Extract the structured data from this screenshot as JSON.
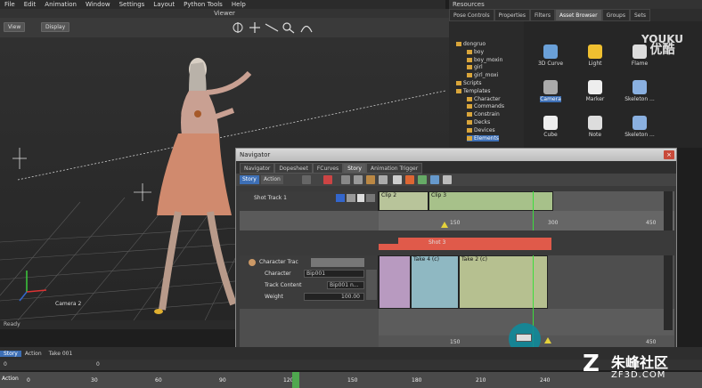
{
  "menu": [
    "File",
    "Edit",
    "Animation",
    "Window",
    "Settings",
    "Layout",
    "Python Tools",
    "Help"
  ],
  "viewer": {
    "title": "Viewer",
    "view_label": "View",
    "display_label": "Display",
    "camera_label": "Camera 2",
    "status": "Ready"
  },
  "resources": {
    "title": "Resources",
    "tabs": [
      "Pose Controls",
      "Properties",
      "Filters",
      "Asset Browser",
      "Groups",
      "Sets"
    ],
    "active_tab": 3,
    "tree": [
      "dongruo",
      "boy",
      "boy_moxin",
      "girl",
      "girl_moxi",
      "Scripts",
      "Templates",
      "Character",
      "Commands",
      "Constrain",
      "Decks",
      "Devices",
      "Elements"
    ],
    "assets": [
      {
        "name": "3D Curve",
        "icon": "curve-icon"
      },
      {
        "name": "Light",
        "icon": "light-icon"
      },
      {
        "name": "Flame",
        "icon": "flame-icon"
      },
      {
        "name": "Camera",
        "icon": "camera-icon"
      },
      {
        "name": "Marker",
        "icon": "marker-icon"
      },
      {
        "name": "Skeleton ...",
        "icon": "skeleton-icon"
      },
      {
        "name": "Cube",
        "icon": "cube-icon"
      },
      {
        "name": "Note",
        "icon": "note-icon"
      },
      {
        "name": "Skeleton ...",
        "icon": "skeleton-icon"
      }
    ],
    "selected_asset": 3
  },
  "navigator": {
    "title": "Navigator",
    "close": "×",
    "tabs": [
      "Navigator",
      "Dopesheet",
      "FCurves",
      "Story",
      "Animation Trigger"
    ],
    "active_tab": 3,
    "toolbar": {
      "story": "Story",
      "action": "Action"
    },
    "shot_track": "Shot Track 1",
    "clips": {
      "clip2": "Clip 2",
      "clip3": "Clip 3",
      "shot3": "Shot 3",
      "take4": "Take 4 (c)",
      "take2": "Take 2 (c)"
    },
    "ruler": {
      "a": "150",
      "b": "300",
      "c": "450"
    },
    "char_track": "Character Trac",
    "character_label": "Character",
    "character_value": "Bip001",
    "track_content_label": "Track Content",
    "track_content_value": "Bip001 n...",
    "weight_label": "Weight",
    "weight_value": "100.00"
  },
  "bottom": {
    "story": "Story",
    "action": "Action",
    "take": "Take 001",
    "frame_start": "0",
    "frame_cur": "0",
    "ticks": [
      "0",
      "30",
      "60",
      "90",
      "120",
      "150",
      "180",
      "210",
      "240"
    ],
    "action_label": "Action"
  },
  "watermarks": {
    "youku": "YOUKU",
    "youku_cn": "优酷",
    "zf": "朱峰社区",
    "zf_url": "ZF3D.COM"
  },
  "colors": {
    "accent": "#3d6fb5",
    "clip_green": "#a7c18a",
    "shot_red": "#e05a4a",
    "cursor": "#0f8a9a"
  }
}
